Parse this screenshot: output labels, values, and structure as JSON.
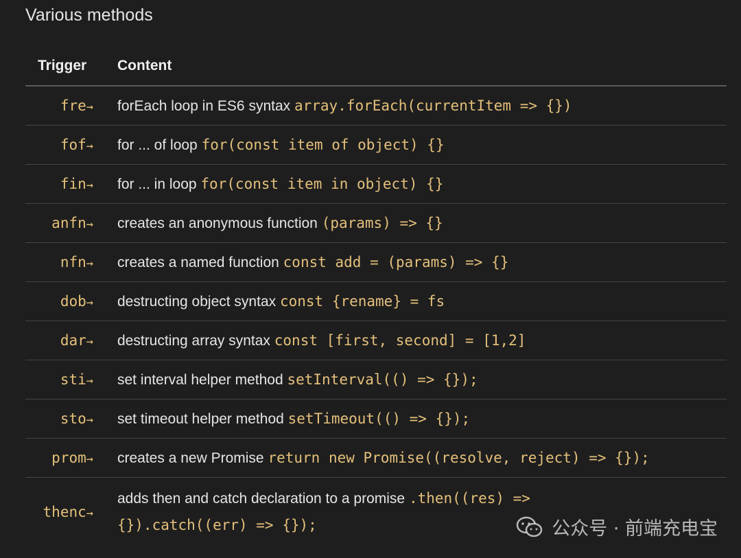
{
  "heading": "Various methods",
  "columns": {
    "trigger": "Trigger",
    "content": "Content"
  },
  "arrow": "→",
  "rows": [
    {
      "trigger": "fre",
      "text": "forEach loop in ES6 syntax ",
      "code": "array.forEach(currentItem => {})"
    },
    {
      "trigger": "fof",
      "text": "for ... of loop ",
      "code": "for(const item of object) {}"
    },
    {
      "trigger": "fin",
      "text": "for ... in loop ",
      "code": "for(const item in object) {}"
    },
    {
      "trigger": "anfn",
      "text": "creates an anonymous function ",
      "code": "(params) => {}"
    },
    {
      "trigger": "nfn",
      "text": "creates a named function ",
      "code": "const add = (params) => {}"
    },
    {
      "trigger": "dob",
      "text": "destructing object syntax ",
      "code": "const {rename} = fs"
    },
    {
      "trigger": "dar",
      "text": "destructing array syntax ",
      "code": "const [first, second] = [1,2]"
    },
    {
      "trigger": "sti",
      "text": "set interval helper method ",
      "code": "setInterval(() => {});"
    },
    {
      "trigger": "sto",
      "text": "set timeout helper method ",
      "code": "setTimeout(() => {});"
    },
    {
      "trigger": "prom",
      "text": "creates a new Promise ",
      "code": "return new Promise((resolve, reject) => {});"
    },
    {
      "trigger": "thenc",
      "text": "adds then and catch declaration to a promise ",
      "code": ".then((res) =>",
      "code_line2": "{}).catch((err) => {});"
    }
  ],
  "watermark": "公众号 · 前端充电宝"
}
